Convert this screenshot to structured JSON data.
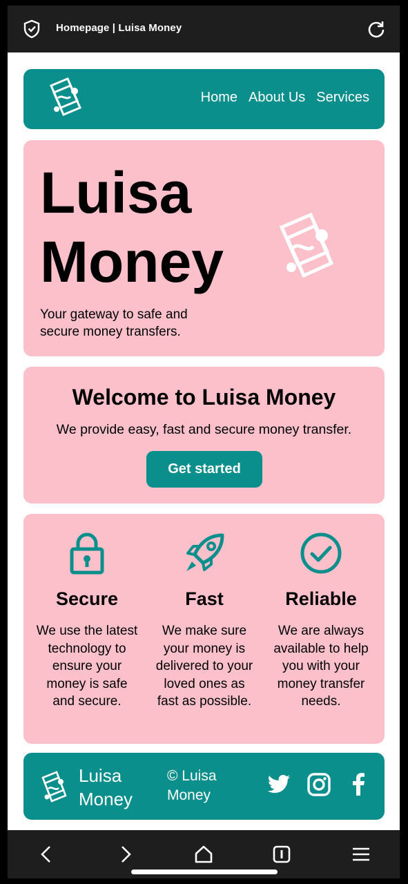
{
  "browser": {
    "tab_title": "Homepage | Luisa Money"
  },
  "nav": {
    "links": [
      "Home",
      "About Us",
      "Services"
    ]
  },
  "hero": {
    "title": "Luisa Money",
    "tagline": "Your gateway to safe and secure money transfers."
  },
  "welcome": {
    "heading": "Welcome to Luisa Money",
    "text": "We provide easy, fast and secure money transfer.",
    "cta": "Get started"
  },
  "features": [
    {
      "icon": "lock-icon",
      "title": "Secure",
      "text": "We use the latest technology to ensure your money is safe and secure."
    },
    {
      "icon": "rocket-icon",
      "title": "Fast",
      "text": "We make sure your money is delivered to your loved ones as fast as possible."
    },
    {
      "icon": "check-circle-icon",
      "title": "Reliable",
      "text": "We are always available to help you with your money transfer needs."
    }
  ],
  "footer": {
    "brand": "Luisa Money",
    "copyright": "© Luisa Money",
    "social": [
      "twitter-icon",
      "instagram-icon",
      "facebook-icon"
    ]
  },
  "colors": {
    "teal": "#0b8f8c",
    "pink": "#fcc0cb",
    "dark_bar": "#1e1e1e"
  }
}
